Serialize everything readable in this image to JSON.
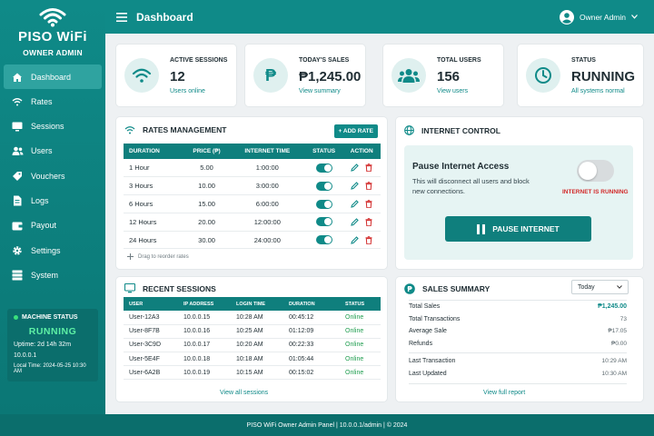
{
  "brand": {
    "title": "PISO WiFi",
    "subtitle": "OWNER ADMIN"
  },
  "nav": [
    {
      "label": "Dashboard",
      "icon": "home-icon",
      "active": true
    },
    {
      "label": "Rates",
      "icon": "wifi-icon"
    },
    {
      "label": "Sessions",
      "icon": "monitor-icon"
    },
    {
      "label": "Users",
      "icon": "users-icon"
    },
    {
      "label": "Vouchers",
      "icon": "ticket-icon"
    },
    {
      "label": "Logs",
      "icon": "document-icon"
    },
    {
      "label": "Payout",
      "icon": "wallet-icon"
    },
    {
      "label": "Settings",
      "icon": "gear-icon"
    },
    {
      "label": "System",
      "icon": "server-icon"
    }
  ],
  "machine": {
    "title": "MACHINE STATUS",
    "status": "RUNNING",
    "uptime": "Uptime: 2d 14h 32m",
    "ip": "10.0.0.1",
    "local_time": "Local Time: 2024-05-25 10:30 AM"
  },
  "topbar": {
    "title": "Dashboard",
    "user": "Owner Admin"
  },
  "stats": [
    {
      "label": "ACTIVE SESSIONS",
      "value": "12",
      "sub": "Users online",
      "icon": "wifi-icon"
    },
    {
      "label": "TODAY'S SALES",
      "value": "₱1,245.00",
      "sub": "View summary",
      "icon": "peso-icon"
    },
    {
      "label": "TOTAL USERS",
      "value": "156",
      "sub": "View users",
      "icon": "users-icon"
    },
    {
      "label": "STATUS",
      "value": "RUNNING",
      "sub": "All systems normal",
      "icon": "clock-icon"
    }
  ],
  "rates": {
    "title": "RATES MANAGEMENT",
    "add_label": "+ ADD RATE",
    "columns": [
      "DURATION",
      "PRICE (₱)",
      "INTERNET TIME",
      "STATUS",
      "ACTION"
    ],
    "rows": [
      [
        "1 Hour",
        "5.00",
        "1:00:00"
      ],
      [
        "3 Hours",
        "10.00",
        "3:00:00"
      ],
      [
        "6 Hours",
        "15.00",
        "6:00:00"
      ],
      [
        "12 Hours",
        "20.00",
        "12:00:00"
      ],
      [
        "24 Hours",
        "30.00",
        "24:00:00"
      ]
    ],
    "drag_hint": "Drag to reorder rates"
  },
  "internet": {
    "title": "INTERNET CONTROL",
    "heading": "Pause Internet Access",
    "desc": "This will disconnect all users and block new connections.",
    "state": "INTERNET IS RUNNING",
    "button": "PAUSE INTERNET"
  },
  "sessions": {
    "title": "RECENT SESSIONS",
    "columns": [
      "USER",
      "IP ADDRESS",
      "LOGIN TIME",
      "DURATION",
      "STATUS"
    ],
    "rows": [
      [
        "User-12A3",
        "10.0.0.15",
        "10:28 AM",
        "00:45:12",
        "Online"
      ],
      [
        "User-8F7B",
        "10.0.0.16",
        "10:25 AM",
        "01:12:09",
        "Online"
      ],
      [
        "User-3C9D",
        "10.0.0.17",
        "10:20 AM",
        "00:22:33",
        "Online"
      ],
      [
        "User-5E4F",
        "10.0.0.18",
        "10:18 AM",
        "01:05:44",
        "Online"
      ],
      [
        "User-6A2B",
        "10.0.0.19",
        "10:15 AM",
        "00:15:02",
        "Online"
      ]
    ],
    "link": "View all sessions"
  },
  "summary": {
    "title": "SALES SUMMARY",
    "period": "Today",
    "rows1": [
      [
        "Total Sales",
        "₱1,245.00"
      ],
      [
        "Total Transactions",
        "73"
      ],
      [
        "Average Sale",
        "₱17.05"
      ],
      [
        "Refunds",
        "₱0.00"
      ]
    ],
    "rows2": [
      [
        "Last Transaction",
        "10:29 AM"
      ],
      [
        "Last Updated",
        "10:30 AM"
      ]
    ],
    "link": "View full report"
  },
  "footer": "PISO WiFi Owner Admin Panel  |  10.0.0.1/admin  |  © 2024",
  "colors": {
    "primary": "#0f8a88",
    "dark": "#0b6e6c",
    "online": "#1f9d4f",
    "danger": "#d22b2b"
  }
}
